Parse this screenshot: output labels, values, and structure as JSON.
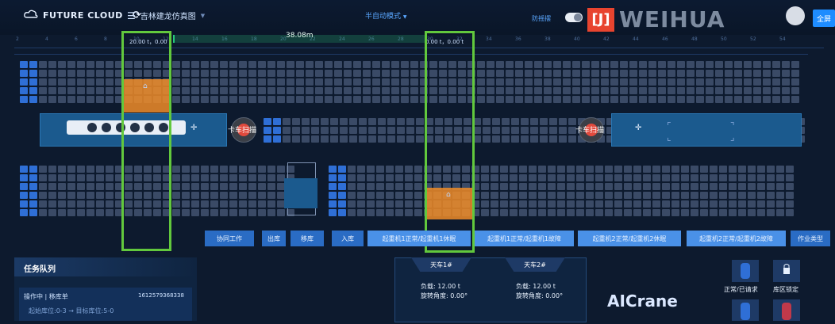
{
  "header": {
    "brand": "FUTURE CLOUD",
    "refresh_icon": "refresh-icon",
    "menu_icon": "menu-icon",
    "breadcrumb": "吉林建龙仿真图",
    "mode": "半自动模式",
    "anti_sway_label": "防摇摆",
    "logo_mark": "[J]",
    "logo_word": "WEIHUA",
    "fullscreen_label": "全屏"
  },
  "ruler": {
    "distance": "38.08m",
    "crane1_pos": "20.00 t，0.00 t",
    "crane2_pos": "0.00 t，0.00 t",
    "ticks": [
      "2",
      "4",
      "6",
      "8",
      "10",
      "12",
      "14",
      "16",
      "18",
      "20",
      "22",
      "24",
      "26",
      "28",
      "30",
      "32",
      "34",
      "36",
      "38",
      "40",
      "42",
      "44",
      "46",
      "48",
      "50",
      "52",
      "54"
    ]
  },
  "scan_left": "卡车扫描",
  "scan_right": "卡车扫描",
  "toolbar": {
    "buttons": [
      "协同工作",
      "出库",
      "移库",
      "入库",
      "起重机1正常/起重机1休眠",
      "起重机1正常/起重机1故障",
      "起重机2正常/起重机2休眠",
      "起重机2正常/起重机2故障",
      "作业类型"
    ]
  },
  "task_queue": {
    "title": "任务队列",
    "item_status": "操作中 | 移库单",
    "item_id": "1612579368338",
    "item_route": "起始库位:0-3 → 目标库位:5-0"
  },
  "cranes": [
    {
      "name": "天车1#",
      "load_label": "负载:",
      "load": "12.00 t",
      "angle_label": "旋转角度:",
      "angle": "0.00°"
    },
    {
      "name": "天车2#",
      "load_label": "负载:",
      "load": "12.00 t",
      "angle_label": "旋转角度:",
      "angle": "0.00°"
    }
  ],
  "aicrane": "AICrane",
  "side": {
    "status_label": "正常/已请求",
    "lock_label": "库区锁定"
  },
  "colors": {
    "accent": "#1e8cff",
    "highlight": "#f08c28",
    "selection": "#62c83d",
    "logo": "#e8442f"
  }
}
